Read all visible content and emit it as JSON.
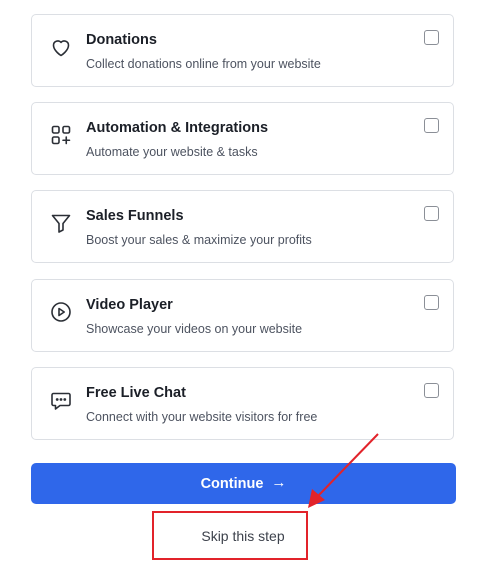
{
  "options": [
    {
      "title": "Donations",
      "description": "Collect donations online from your website",
      "icon": "heart-icon",
      "checked": false
    },
    {
      "title": "Automation & Integrations",
      "description": "Automate your website & tasks",
      "icon": "apps-plus-icon",
      "checked": false
    },
    {
      "title": "Sales Funnels",
      "description": "Boost your sales & maximize your profits",
      "icon": "funnel-icon",
      "checked": false
    },
    {
      "title": "Video Player",
      "description": "Showcase your videos on your website",
      "icon": "play-circle-icon",
      "checked": false
    },
    {
      "title": "Free Live Chat",
      "description": "Connect with your website visitors for free",
      "icon": "chat-bubble-icon",
      "checked": false
    }
  ],
  "continue_button": {
    "label": "Continue",
    "arrow": "→"
  },
  "skip_link": {
    "label": "Skip this step"
  },
  "colors": {
    "primary": "#2f67ea",
    "annotation": "#e2232a",
    "border": "#dcdfe4"
  }
}
